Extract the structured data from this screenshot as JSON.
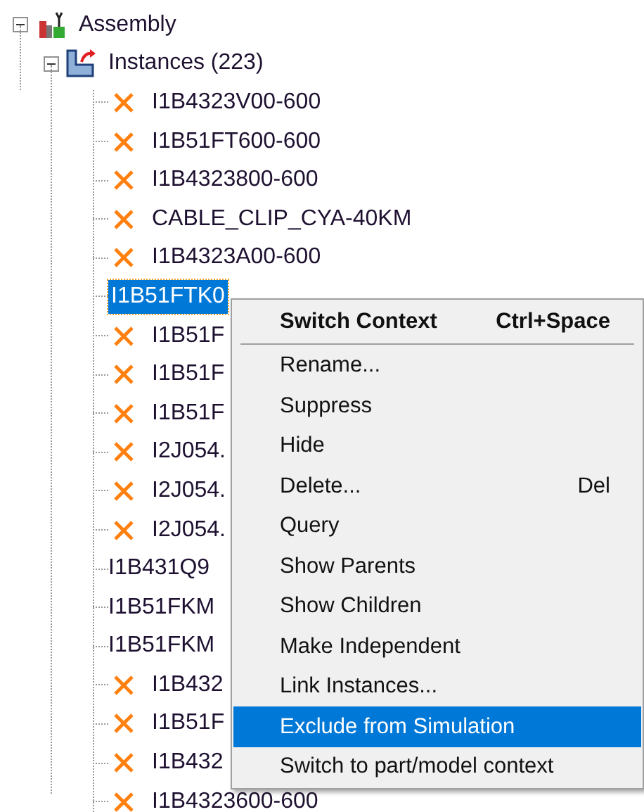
{
  "tree": {
    "label": "Assembly",
    "expanded": true,
    "children": [
      {
        "label": "Instances (223)",
        "expanded": true,
        "children": [
          {
            "label": "I1B4323V00-600",
            "excluded": true,
            "selected": false
          },
          {
            "label": "I1B51FT600-600",
            "excluded": true,
            "selected": false
          },
          {
            "label": "I1B4323800-600",
            "excluded": true,
            "selected": false
          },
          {
            "label": "CABLE_CLIP_CYA-40KM",
            "excluded": true,
            "selected": false
          },
          {
            "label": "I1B4323A00-600",
            "excluded": true,
            "selected": false
          },
          {
            "label": "I1B51FTK0",
            "excluded": false,
            "selected": true
          },
          {
            "label": "I1B51F",
            "excluded": true,
            "selected": false
          },
          {
            "label": "I1B51F",
            "excluded": true,
            "selected": false
          },
          {
            "label": "I1B51F",
            "excluded": true,
            "selected": false
          },
          {
            "label": "I2J054.",
            "excluded": true,
            "selected": false
          },
          {
            "label": "I2J054.",
            "excluded": true,
            "selected": false
          },
          {
            "label": "I2J054.",
            "excluded": true,
            "selected": false
          },
          {
            "label": "I1B431Q9",
            "excluded": false,
            "selected": false
          },
          {
            "label": "I1B51FKM",
            "excluded": false,
            "selected": false
          },
          {
            "label": "I1B51FKM",
            "excluded": false,
            "selected": false
          },
          {
            "label": "I1B432",
            "excluded": true,
            "selected": false
          },
          {
            "label": "I1B51F",
            "excluded": true,
            "selected": false
          },
          {
            "label": "I1B432",
            "excluded": true,
            "selected": false
          },
          {
            "label": "I1B4323600-600",
            "excluded": true,
            "selected": false
          }
        ]
      }
    ]
  },
  "context_menu": {
    "items": [
      {
        "kind": "item",
        "label": "Switch Context",
        "shortcut": "Ctrl+Space",
        "default": true,
        "selected": false
      },
      {
        "kind": "separator"
      },
      {
        "kind": "item",
        "label": "Rename...",
        "default": false,
        "selected": false
      },
      {
        "kind": "item",
        "label": "Suppress",
        "default": false,
        "selected": false
      },
      {
        "kind": "item",
        "label": "Hide",
        "default": false,
        "selected": false
      },
      {
        "kind": "item",
        "label": "Delete...",
        "shortcut": "Del",
        "default": false,
        "selected": false
      },
      {
        "kind": "item",
        "label": "Query",
        "default": false,
        "selected": false
      },
      {
        "kind": "item",
        "label": "Show Parents",
        "default": false,
        "selected": false
      },
      {
        "kind": "item",
        "label": "Show Children",
        "default": false,
        "selected": false
      },
      {
        "kind": "item",
        "label": "Make Independent",
        "default": false,
        "selected": false
      },
      {
        "kind": "item",
        "label": "Link Instances...",
        "default": false,
        "selected": false
      },
      {
        "kind": "item",
        "label": "Exclude from Simulation",
        "default": false,
        "selected": true
      },
      {
        "kind": "item",
        "label": "Switch to part/model context",
        "default": false,
        "selected": false
      }
    ]
  }
}
